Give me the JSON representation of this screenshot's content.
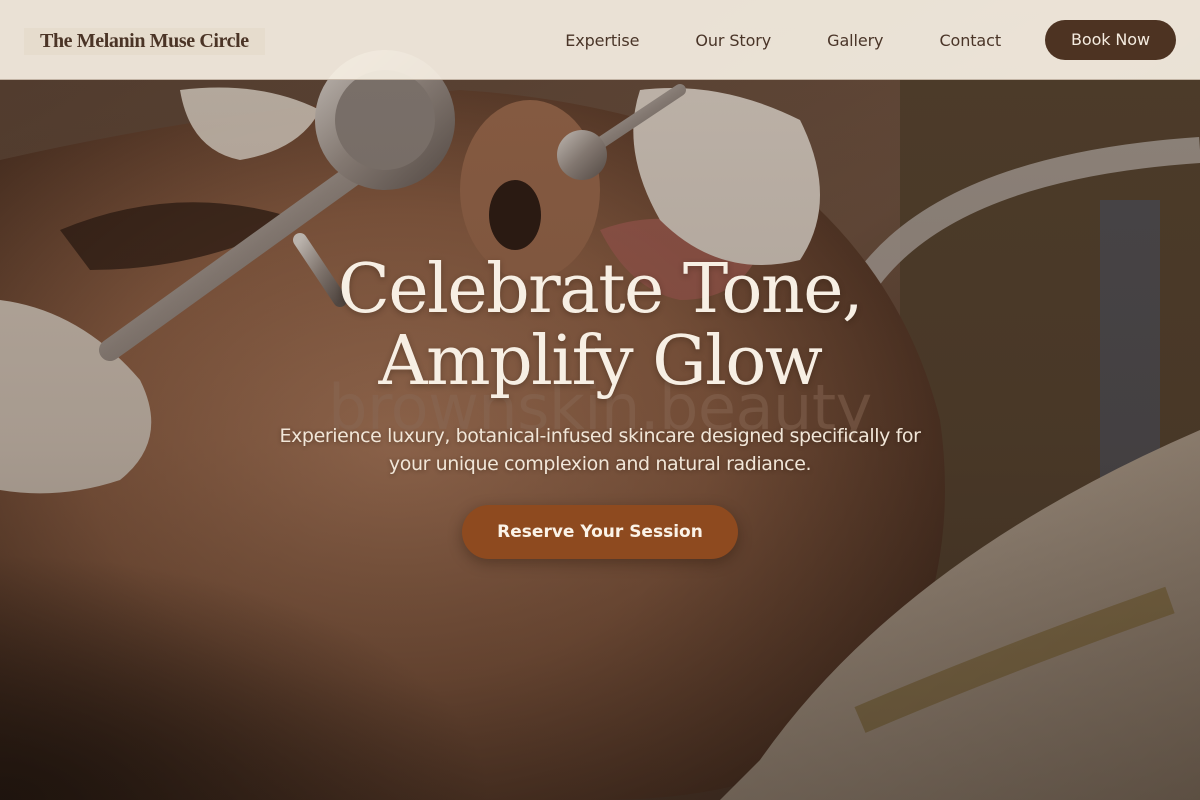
{
  "brand": {
    "name": "The Melanin Muse Circle"
  },
  "nav": {
    "links": [
      "Expertise",
      "Our Story",
      "Gallery",
      "Contact"
    ],
    "cta_label": "Book Now"
  },
  "hero": {
    "title_line1": "Celebrate Tone,",
    "title_line2": "Amplify Glow",
    "watermark": "brownskin.beauty",
    "subtitle": "Experience luxury, botanical-infused skincare designed specifically for your unique complexion and natural radiance.",
    "cta_label": "Reserve Your Session",
    "background_image": "facial-treatment-photo"
  },
  "colors": {
    "nav_background": "#f5eee2",
    "brand_text": "#4b3426",
    "book_button": "#4d3322",
    "cta_button": "#8e4a1f",
    "hero_text": "#f7efe4"
  }
}
